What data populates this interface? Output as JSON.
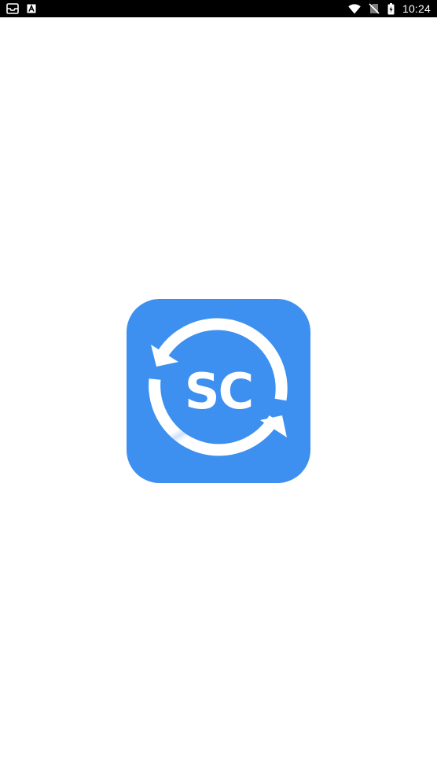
{
  "status_bar": {
    "time": "10:24",
    "left_icons": [
      "inbox-notification-icon",
      "keyboard-a-notification-icon"
    ],
    "right_icons": [
      "wifi-icon",
      "no-sim-icon",
      "battery-icon"
    ]
  },
  "splash": {
    "logo": {
      "text": "SC",
      "color": "#3d8ff0"
    }
  }
}
